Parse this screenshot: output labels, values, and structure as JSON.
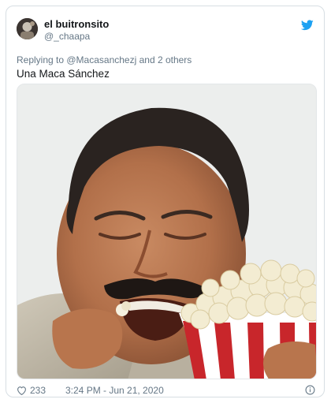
{
  "author": {
    "display_name": "el buitronsito",
    "handle": "@_chaapa"
  },
  "reply_context": {
    "text": "Replying to @Macasanchezj and 2 others"
  },
  "tweet": {
    "text": "Una Maca Sánchez"
  },
  "footer": {
    "like_count": "233",
    "timestamp": "3:24 PM - Jun 21, 2020"
  },
  "icons": {
    "brand": "twitter-bird-icon",
    "like": "heart-icon",
    "info": "info-icon"
  },
  "colors": {
    "twitter_blue": "#1da1f2",
    "secondary_text": "#657786",
    "primary_text": "#14171a",
    "card_border": "#d7dee3"
  }
}
